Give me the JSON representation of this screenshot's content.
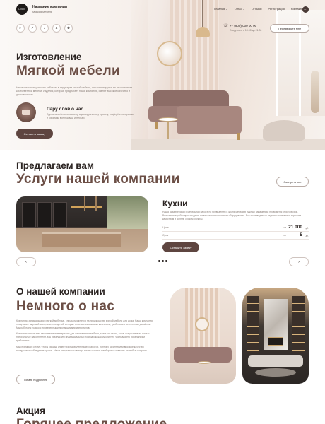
{
  "header": {
    "logo_text": "LOGO",
    "company_name": "Название компании",
    "company_tagline": "Мягкая мебель",
    "nav": [
      "Главная ⌄",
      "О нас ⌄",
      "Отзывы",
      "Регистрация",
      "Контакты ⌄"
    ],
    "menu_icon": "more-icon",
    "phone": "+7 (900) 000 00 00",
    "hours": "Ежедневно с 10:00 до 21:00",
    "callback_label": "Перезвоните мне"
  },
  "socials": [
    {
      "name": "telegram-icon",
      "glyph": "➤"
    },
    {
      "name": "vk-icon",
      "glyph": "✓"
    },
    {
      "name": "twitter-icon",
      "glyph": "♪"
    },
    {
      "name": "snapchat-icon",
      "glyph": "♣"
    },
    {
      "name": "vk-alt-icon",
      "glyph": "♚"
    }
  ],
  "hero": {
    "title_line1": "Изготовление",
    "title_line2": "Мягкой мебели",
    "description": "Наша компания успешно работает в индустрии мягкой мебели, специализируясь на изготовлении качественной мебели. Изделия, которые предлагает наша компания, имеют высокое качество и долговечность.",
    "about_title": "Пару слов о нас",
    "about_text": "Сделаем мебель по вашему индивидуальному проекту, подберём материалы и оформим всё под ваш интерьер.",
    "order_label": "Оставить заявку"
  },
  "services": {
    "title_line1": "Предлагаем вам",
    "title_line2": "Услуги нашей компании",
    "all_label": "Смотреть все",
    "item_title": "Кухни",
    "item_desc": "Наша дизайнерская и мебельная работа по приведению в жизнь мебели в нужных параметрах проводится строго в срок. Выполнение работ производится на высокотехнологичном оборудовании. Все производимые изделия отличаются хорошим качеством и долгим сроком службы.",
    "prices": [
      {
        "label": "Цена",
        "from": "от",
        "value": "21 000",
        "unit": "руб."
      },
      {
        "label": "Срок",
        "from": "от",
        "value": "5",
        "unit": "дн."
      }
    ],
    "order_label": "Оставить заявку",
    "prev_icon": "‹",
    "next_icon": "›"
  },
  "about": {
    "title_line1": "О нашей компании",
    "title_line2": "Немного о нас",
    "paragraphs": [
      "Компания, занимающаяся мягкой мебелью, специализируется на производстве мягкой мебели для дома. Наша компания предлагает широкий ассортимент изделий, которые отличаются высоким качеством, удобством и эстетичным дизайном. Мы работаем только с проверенными поставщиками материалов.",
      "Компания использует качественные материалы для изготовления мебели, такие как ткани, кожа, искусственная кожа и натуральные наполнители. Мы предлагаем индивидуальный подход к каждому клиенту, учитывая его пожелания и требования.",
      "Мы стремимся к тому, чтобы каждый клиент был доволен нашей работой, поэтому гарантируем высокое качество продукции и соблюдение сроков. Наши специалисты всегда готовы помочь с выбором и ответить на любые вопросы."
    ],
    "more_label": "Узнать подробнее"
  },
  "promo": {
    "title_line1": "Акция",
    "title_line2": "Горячее предложение"
  },
  "colors": {
    "accent": "#5e4540",
    "heading_brown": "#6b4e45",
    "text_dark": "#2b2422",
    "text_muted": "#8a7f79"
  }
}
